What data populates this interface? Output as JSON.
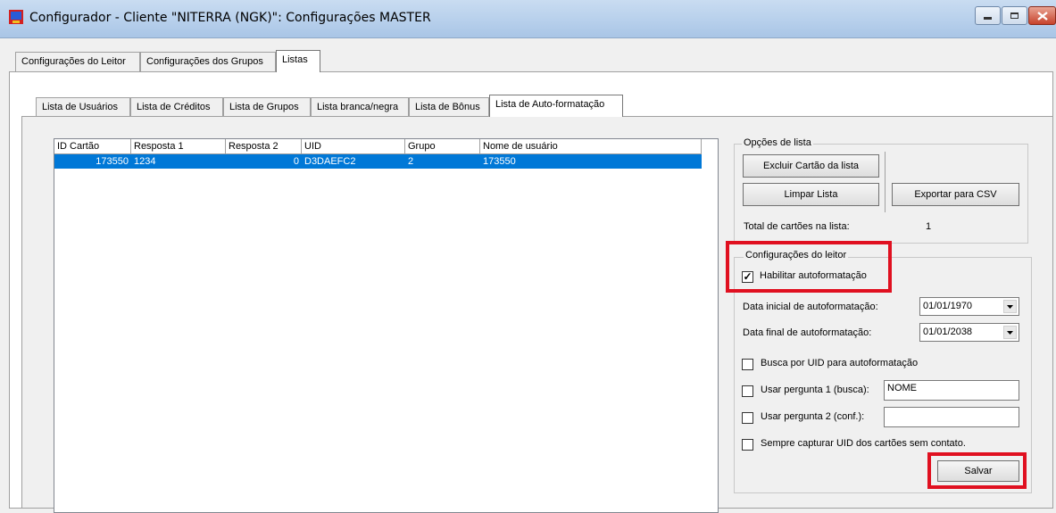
{
  "window": {
    "title": "Configurador - Cliente \"NITERRA (NGK)\": Configurações MASTER",
    "minimize_icon": "minimize-icon",
    "maximize_icon": "maximize-icon",
    "close_icon": "close-icon"
  },
  "main_tabs": [
    {
      "label": "Configurações do Leitor"
    },
    {
      "label": "Configurações dos Grupos"
    },
    {
      "label": "Listas",
      "active": true
    }
  ],
  "sub_tabs": [
    {
      "label": "Lista de Usuários"
    },
    {
      "label": "Lista de Créditos"
    },
    {
      "label": "Lista de Grupos"
    },
    {
      "label": "Lista branca/negra"
    },
    {
      "label": "Lista de Bônus"
    },
    {
      "label": "Lista de Auto-formatação",
      "active": true
    }
  ],
  "table": {
    "columns": [
      "ID Cartão",
      "Resposta 1",
      "Resposta 2",
      "UID",
      "Grupo",
      "Nome de usuário"
    ],
    "rows": [
      {
        "id_cartao": "173550",
        "resposta1": "1234",
        "resposta2": "0",
        "uid": "D3DAEFC2",
        "grupo": "2",
        "nome": "173550",
        "selected": true
      }
    ]
  },
  "list_options": {
    "title": "Opções de lista",
    "remove_card_button": "Excluir Cartão da lista",
    "clear_list_button": "Limpar Lista",
    "export_csv_button": "Exportar para CSV",
    "total_label": "Total de cartões na lista:",
    "total_value": "1"
  },
  "reader_settings": {
    "title": "Configurações do leitor",
    "enable_autoformat": {
      "label": "Habilitar autoformatação",
      "checked": true
    },
    "start_date": {
      "label": "Data inicial de autoformatação:",
      "value": "01/01/1970"
    },
    "end_date": {
      "label": "Data final de autoformatação:",
      "value": "01/01/2038"
    },
    "search_by_uid": {
      "label": "Busca por UID para autoformatação",
      "checked": false
    },
    "use_question1": {
      "label": "Usar pergunta 1 (busca):",
      "checked": false,
      "value": "NOME"
    },
    "use_question2": {
      "label": "Usar pergunta 2 (conf.):",
      "checked": false,
      "value": ""
    },
    "always_capture_uid": {
      "label": "Sempre capturar UID dos cartões sem contato.",
      "checked": false
    },
    "save_button": "Salvar"
  },
  "colors": {
    "selection": "#0078d7",
    "highlight_box": "#e01020"
  }
}
